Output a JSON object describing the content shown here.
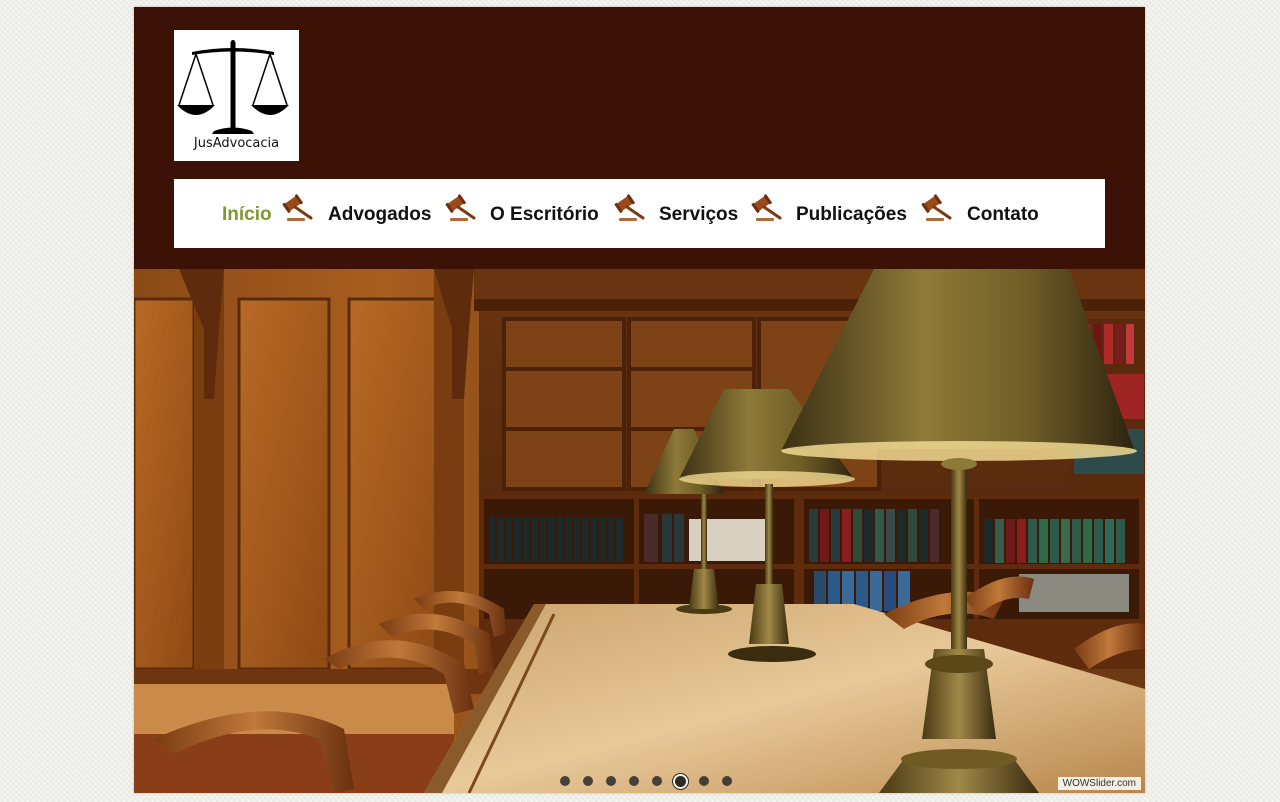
{
  "logo": {
    "text": "JusAdvocacia",
    "icon": "scales-of-justice-icon"
  },
  "nav": {
    "items": [
      {
        "label": "Início",
        "active": true
      },
      {
        "label": "Advogados",
        "active": false
      },
      {
        "label": "O Escritório",
        "active": false
      },
      {
        "label": "Serviços",
        "active": false
      },
      {
        "label": "Publicações",
        "active": false
      },
      {
        "label": "Contato",
        "active": false
      }
    ],
    "separator_icon": "gavel-icon",
    "active_color": "#7f9a2c"
  },
  "slider": {
    "image": "law-library-conference-room",
    "slide_count": 8,
    "active_slide": 6,
    "credit": "WOWSlider.com"
  },
  "colors": {
    "header_bg": "#3d1206",
    "page_bg": "#efefea"
  }
}
